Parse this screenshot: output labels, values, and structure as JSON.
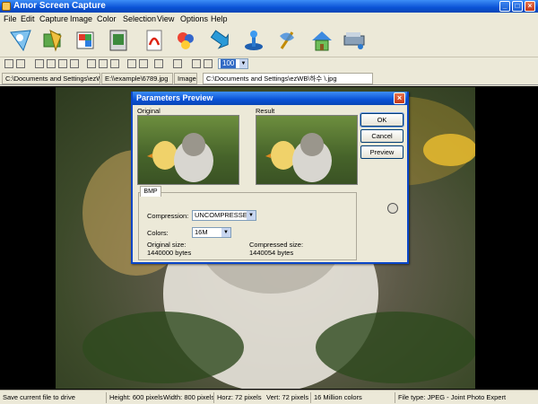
{
  "window": {
    "title": "Amor Screen Capture"
  },
  "menu": [
    "File",
    "Edit",
    "Capture",
    "Image",
    "Color",
    "Selection",
    "View",
    "Options",
    "Help"
  ],
  "toolbar_icons": [
    "capture-icon",
    "capture-window-icon",
    "capture-region-icon",
    "capture-object-icon",
    "pdf-icon",
    "paint-icon",
    "arrow-down-icon",
    "joystick-icon",
    "wizard-icon",
    "home-icon",
    "scanner-icon"
  ],
  "small_toolbar": {
    "zoom": "100"
  },
  "tabs": [
    {
      "label": "C:\\Documents and Settings\\ezWB\\"
    },
    {
      "label": "E:\\\\example\\6789.jpg"
    },
    {
      "label": "Image"
    },
    {
      "label": "C:\\Documents and Settings\\ezWB\\하수 \\.jpg"
    }
  ],
  "dialog": {
    "title": "Parameters Preview",
    "original_label": "Original",
    "result_label": "Result",
    "ok": "OK",
    "cancel": "Cancel",
    "preview": "Preview",
    "group_tab": "BMP",
    "compression_label": "Compression:",
    "compression_value": "UNCOMPRESSED",
    "colors_label": "Colors:",
    "colors_value": "16M",
    "original_size_label": "Original size:",
    "original_size_value": "1440000 bytes",
    "compressed_size_label": "Compressed size:",
    "compressed_size_value": "1440054 bytes"
  },
  "status": {
    "message": "Save current file to drive",
    "height": "Height: 600 pixels",
    "width": "Width: 800 pixels",
    "horz": "Horz: 72 pixels",
    "vert": "Vert: 72 pixels",
    "colors": "16 Million colors",
    "filetype": "File type: JPEG - Joint Photo Expert"
  },
  "colors": {
    "titlebar": "#0a52d6",
    "chrome": "#ece9d8",
    "canvas": "#000000",
    "selection": "#316ac5"
  }
}
